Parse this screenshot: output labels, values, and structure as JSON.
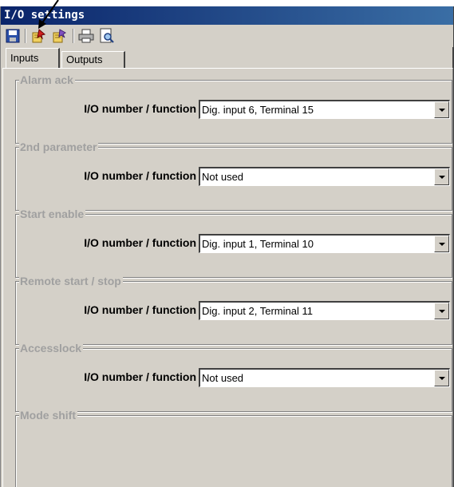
{
  "window": {
    "title": "I/O settings"
  },
  "toolbar": {
    "buttons": [
      {
        "icon": "save-icon"
      },
      {
        "icon": "write-to-device-icon"
      },
      {
        "icon": "read-from-device-icon"
      },
      {
        "icon": "print-icon"
      },
      {
        "icon": "print-preview-icon"
      }
    ]
  },
  "tabs": [
    {
      "label": "Inputs",
      "active": true
    },
    {
      "label": "Outputs",
      "active": false
    }
  ],
  "groups": [
    {
      "title": "Alarm ack",
      "label": "I/O number / function",
      "value": "Dig. input 6, Terminal  15"
    },
    {
      "title": "2nd parameter",
      "label": "I/O number / function",
      "value": "Not used"
    },
    {
      "title": "Start enable",
      "label": "I/O number / function",
      "value": "Dig. input 1, Terminal  10"
    },
    {
      "title": "Remote start / stop",
      "label": "I/O number / function",
      "value": "Dig. input 2, Terminal  11"
    },
    {
      "title": "Accesslock",
      "label": "I/O number / function",
      "value": "Not used"
    },
    {
      "title": "Mode shift"
    }
  ],
  "colors": {
    "titlebar_start": "#0a246a",
    "titlebar_end": "#3a6ea5",
    "face": "#d4d0c8",
    "group_title": "#a0a0a0"
  }
}
